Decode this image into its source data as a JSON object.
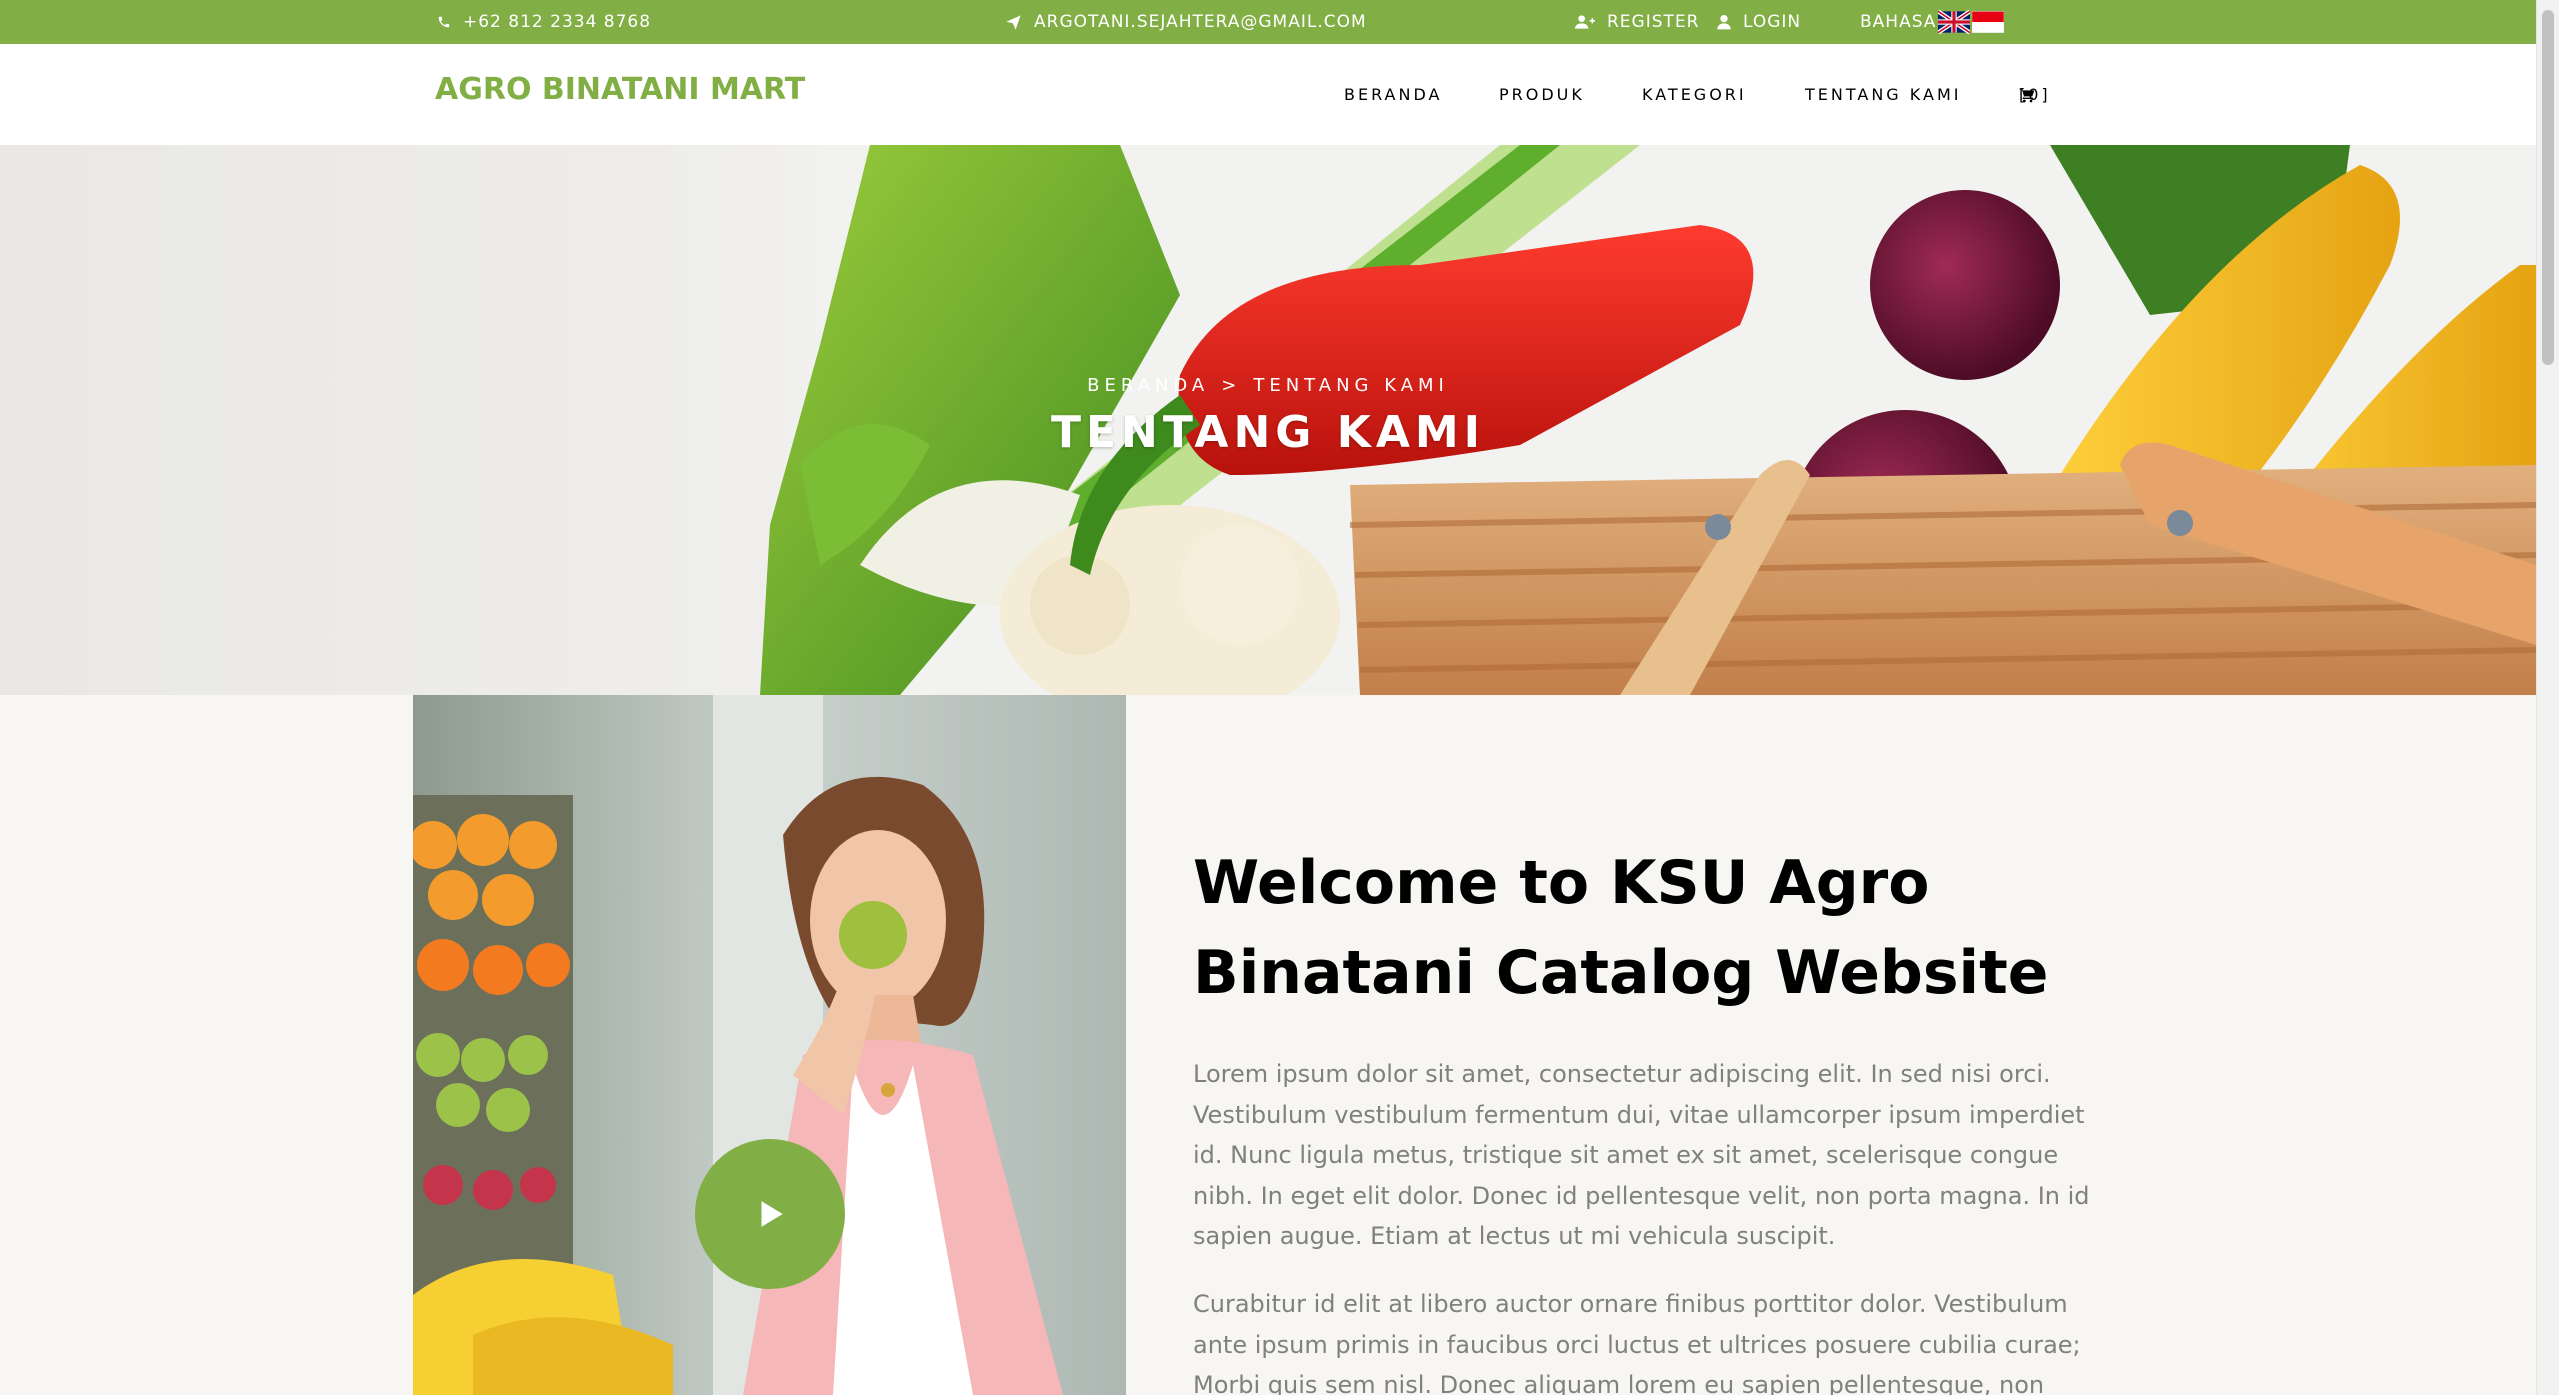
{
  "topbar": {
    "phone": "+62 812 2334 8768",
    "email": "ARGOTANI.SEJAHTERA@GMAIL.COM",
    "register_label": "REGISTER",
    "login_label": "LOGIN",
    "language_label": "BAHASA"
  },
  "nav": {
    "brand": "AGRO BINATANI MART",
    "items": [
      {
        "label": "BERANDA"
      },
      {
        "label": "PRODUK"
      },
      {
        "label": "KATEGORI"
      },
      {
        "label": "TENTANG KAMI"
      }
    ],
    "cart_label": "[0]"
  },
  "hero": {
    "breadcrumb_home": "BERANDA",
    "breadcrumb_separator": ">",
    "breadcrumb_current": "TENTANG KAMI",
    "title": "TENTANG KAMI"
  },
  "about": {
    "title": "Welcome to KSU Agro Binatani Catalog Website",
    "paragraph1": "Lorem ipsum dolor sit amet, consectetur adipiscing elit. In sed nisi orci. Vestibulum vestibulum fermentum dui, vitae ullamcorper ipsum imperdiet id. Nunc ligula metus, tristique sit amet ex sit amet, scelerisque congue nibh. In eget elit dolor. Donec id pellentesque velit, non porta magna. In id sapien augue. Etiam at lectus ut mi vehicula suscipit.",
    "paragraph2": "Curabitur id elit at libero auctor ornare finibus porttitor dolor. Vestibulum ante ipsum primis in faucibus orci luctus et ultrices posuere cubilia curae; Morbi quis sem nisl. Donec aliquam lorem eu sapien pellentesque, non semper dui"
  },
  "colors": {
    "accent": "#82ae46"
  }
}
